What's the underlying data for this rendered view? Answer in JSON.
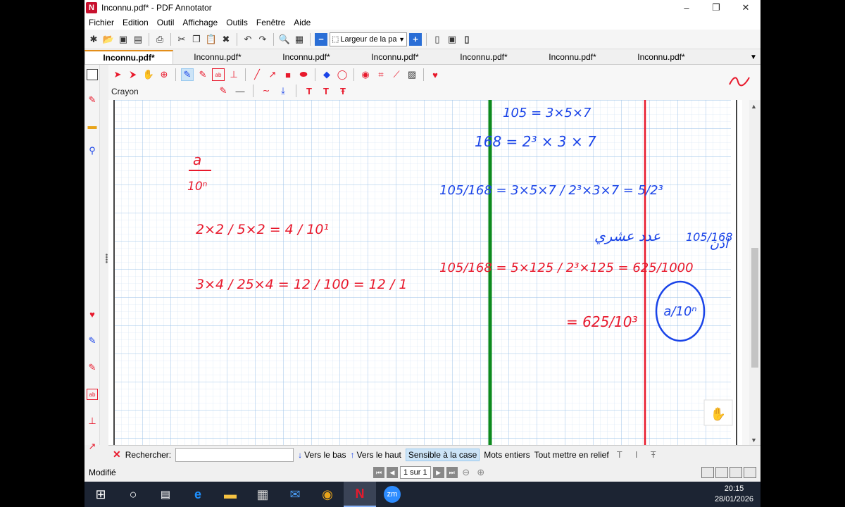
{
  "window": {
    "title": "Inconnu.pdf* - PDF Annotator",
    "minimize": "–",
    "restore": "❐",
    "close": "✕"
  },
  "menu": [
    "Fichier",
    "Edition",
    "Outil",
    "Affichage",
    "Outils",
    "Fenêtre",
    "Aide"
  ],
  "toolbar": {
    "zoom_value": "Largeur de la pa"
  },
  "tabs": [
    "Inconnu.pdf*",
    "Inconnu.pdf*",
    "Inconnu.pdf*",
    "Inconnu.pdf*",
    "Inconnu.pdf*",
    "Inconnu.pdf*",
    "Inconnu.pdf*"
  ],
  "annotation_toolbar": {
    "current_tool": "Crayon"
  },
  "handwriting": {
    "left": {
      "frac1_num": "a",
      "frac1_den": "10ⁿ",
      "eq1": "2×2 / 5×2 = 4 / 10¹",
      "eq2": "3×4 / 25×4 = 12 / 100 = 12 / 1"
    },
    "right": {
      "top_partial": "105 = 3×5×7",
      "line1": "168 = 2³ × 3 × 7",
      "line2": "105/168 = 3×5×7 / 2³×3×7 = 5/2³",
      "arabic": "عدد عشري",
      "arabic2": "اذن",
      "side_frac": "105/168",
      "line3": "105/168 = 5×125 / 2³×125 = 625/1000",
      "line4": "= 625/10³",
      "circled": "a/10ⁿ"
    }
  },
  "search": {
    "label": "Rechercher:",
    "down": "Vers le bas",
    "up": "Vers le haut",
    "case": "Sensible à la case",
    "whole_words": "Mots entiers",
    "highlight_all": "Tout mettre en relief"
  },
  "status": {
    "text": "Modifié",
    "page": "1 sur 1"
  },
  "clock": {
    "time": "20:15",
    "date": "28/01/2026"
  },
  "colors": {
    "grid": "#9ec3e8",
    "red_ink": "#e8192c",
    "blue_ink": "#1a44e8",
    "green_line": "#0d8a1e"
  }
}
